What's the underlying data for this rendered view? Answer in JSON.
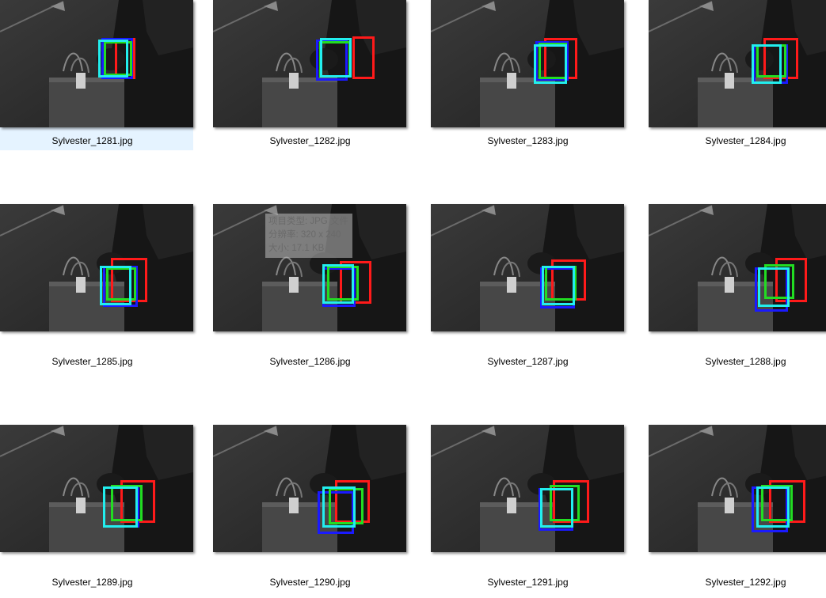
{
  "files": [
    {
      "name": "Sylvester_1281.jpg",
      "selected": true
    },
    {
      "name": "Sylvester_1282.jpg",
      "selected": false
    },
    {
      "name": "Sylvester_1283.jpg",
      "selected": false
    },
    {
      "name": "Sylvester_1284.jpg",
      "selected": false
    },
    {
      "name": "Sylvester_1285.jpg",
      "selected": false
    },
    {
      "name": "Sylvester_1286.jpg",
      "selected": false
    },
    {
      "name": "Sylvester_1287.jpg",
      "selected": false
    },
    {
      "name": "Sylvester_1288.jpg",
      "selected": false
    },
    {
      "name": "Sylvester_1289.jpg",
      "selected": false
    },
    {
      "name": "Sylvester_1290.jpg",
      "selected": false
    },
    {
      "name": "Sylvester_1291.jpg",
      "selected": false
    },
    {
      "name": "Sylvester_1292.jpg",
      "selected": false
    }
  ],
  "tooltip": {
    "type_line": "项目类型: JPG 文件",
    "resolution_line": "分辨率: 320 x 240",
    "size_line": "大小: 17.1 KB"
  },
  "box_colors": {
    "red": "#ff1a1a",
    "green": "#22dd22",
    "blue": "#1a1aff",
    "cyan": "#22eeee"
  },
  "selection_color": "#e5f3ff"
}
